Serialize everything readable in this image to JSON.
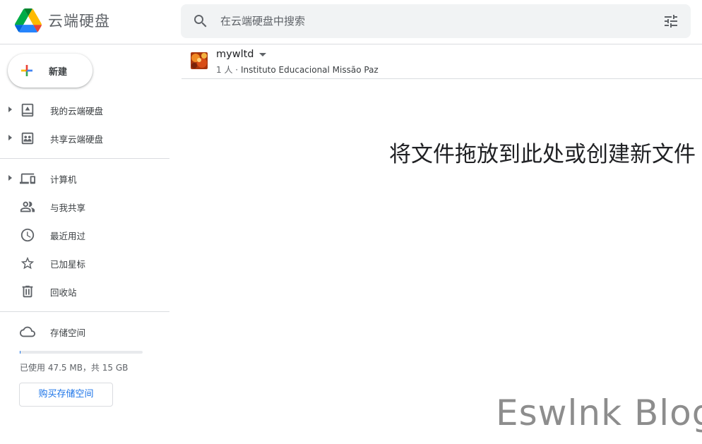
{
  "header": {
    "app_title": "云端硬盘",
    "logo_icon": "google-drive-logo",
    "search": {
      "placeholder": "在云端硬盘中搜索",
      "value": ""
    }
  },
  "sidebar": {
    "new_button": {
      "label": "新建",
      "icon": "plus-icon"
    },
    "items": [
      {
        "label": "我的云端硬盘",
        "icon": "my-drive-icon",
        "expandable": true
      },
      {
        "label": "共享云端硬盘",
        "icon": "shared-drives-icon",
        "expandable": true
      },
      {
        "label": "计算机",
        "icon": "computers-icon",
        "expandable": true
      },
      {
        "label": "与我共享",
        "icon": "people-icon",
        "expandable": false
      },
      {
        "label": "最近用过",
        "icon": "clock-icon",
        "expandable": false
      },
      {
        "label": "已加星标",
        "icon": "star-icon",
        "expandable": false
      },
      {
        "label": "回收站",
        "icon": "trash-icon",
        "expandable": false
      }
    ],
    "storage": {
      "label": "存储空间",
      "icon": "cloud-icon",
      "usage_text": "已使用 47.5 MB，共 15 GB",
      "used_fraction": 0.003,
      "buy_button": "购买存储空间"
    }
  },
  "main": {
    "drive": {
      "name": "mywltd",
      "members": "1 人",
      "separator": "·",
      "organization": "Instituto Educacional Missão Paz"
    },
    "empty_hint": "将文件拖放到此处或创建新文件"
  },
  "watermark": "Eswlnk Blog",
  "colors": {
    "accent": "#1a73e8",
    "text_primary": "#202124",
    "text_secondary": "#5f6368",
    "divider": "#dadce0",
    "search_bg": "#f1f3f4"
  }
}
